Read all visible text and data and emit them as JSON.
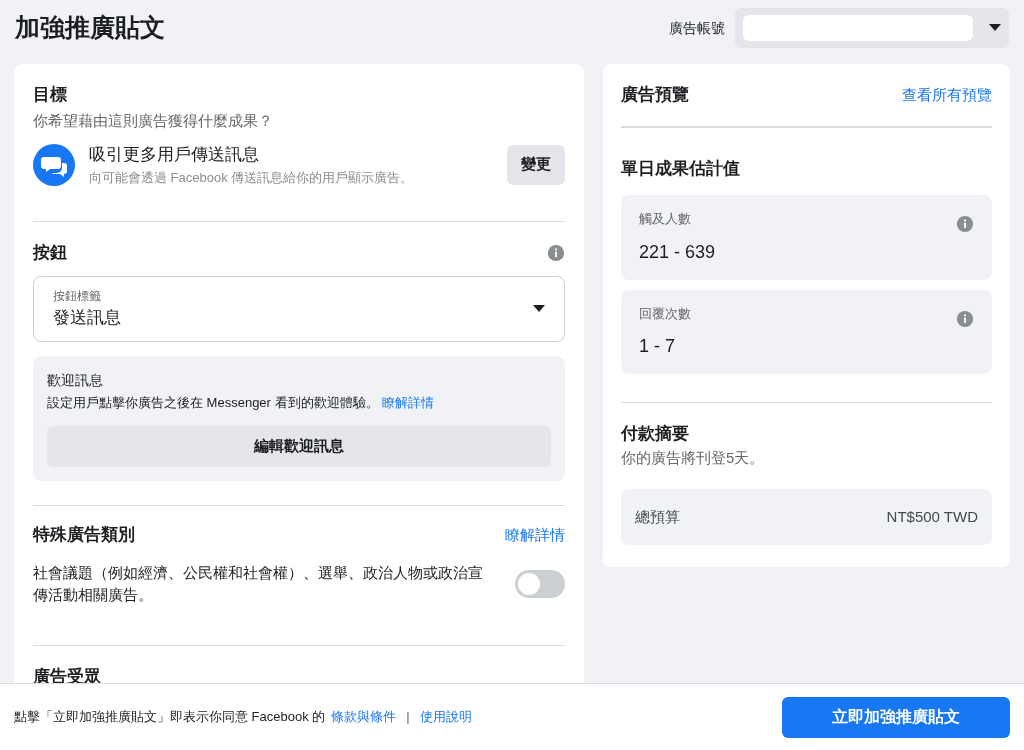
{
  "header": {
    "title": "加強推廣貼文",
    "account_label": "廣告帳號"
  },
  "objective": {
    "heading": "目標",
    "question": "你希望藉由這則廣告獲得什麼成果？",
    "choice_title": "吸引更多用戶傳送訊息",
    "choice_desc": "向可能會透過 Facebook 傳送訊息給你的用戶顯示廣告。",
    "change_button": "變更"
  },
  "button_section": {
    "heading": "按鈕",
    "select_label": "按鈕標籤",
    "select_value": "發送訊息",
    "welcome": {
      "title": "歡迎訊息",
      "text": "設定用戶點擊你廣告之後在 Messenger 看到的歡迎體驗。",
      "link": "瞭解詳情",
      "edit_button": "編輯歡迎訊息"
    }
  },
  "special_category": {
    "heading": "特殊廣告類別",
    "link": "瞭解詳情",
    "text": "社會議題（例如經濟、公民權和社會權）、選舉、政治人物或政治宣傳活動相關廣告。",
    "on": false
  },
  "audience": {
    "heading": "廣告受眾"
  },
  "preview": {
    "heading": "廣告預覽",
    "link": "查看所有預覽"
  },
  "estimates": {
    "heading": "單日成果估計值",
    "metrics": [
      {
        "label": "觸及人數",
        "value": "221 - 639"
      },
      {
        "label": "回覆次數",
        "value": "1 - 7"
      }
    ]
  },
  "payment": {
    "heading": "付款摘要",
    "note": "你的廣告將刊登5天。",
    "budget_label": "總預算",
    "budget_value": "NT$500 TWD"
  },
  "footer": {
    "text": "點擊「立即加強推廣貼文」即表示你同意 Facebook 的",
    "terms_link": "條款與條件",
    "separator": "|",
    "help_link": "使用說明",
    "boost_button": "立即加強推廣貼文"
  }
}
